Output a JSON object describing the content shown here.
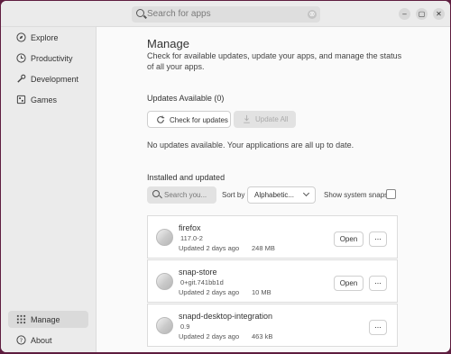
{
  "titlebar": {
    "search_placeholder": "Search for apps",
    "clear_glyph": "⊗",
    "minimize_glyph": "–",
    "maximize_glyph": "▢",
    "close_glyph": "✕"
  },
  "sidebar": {
    "explore": "Explore",
    "productivity": "Productivity",
    "development": "Development",
    "games": "Games",
    "manage": "Manage",
    "about": "About"
  },
  "main": {
    "title": "Manage",
    "description": "Check for available updates, update your apps, and manage the status of all your apps.",
    "updates_heading": "Updates Available (0)",
    "check_updates_label": "Check for updates",
    "update_all_label": "Update All",
    "no_updates_text": "No updates available. Your applications are all up to date.",
    "installed_heading": "Installed and updated",
    "search_placeholder": "Search you...",
    "sort_by_label": "Sort by",
    "sort_value": "Alphabetic...",
    "show_snaps_label": "Show system snaps",
    "show_snaps_checked": false
  },
  "apps": [
    {
      "name": "firefox",
      "version": "117.0-2",
      "updated": "Updated 2 days ago",
      "size": "248 MB",
      "open_label": "Open",
      "more_label": "...",
      "has_open": true
    },
    {
      "name": "snap-store",
      "version": "0+git.741bb1d",
      "updated": "Updated 2 days ago",
      "size": "10 MB",
      "open_label": "Open",
      "more_label": "...",
      "has_open": true
    },
    {
      "name": "snapd-desktop-integration",
      "version": "0.9",
      "updated": "Updated 2 days ago",
      "size": "463 kB",
      "more_label": "...",
      "has_open": false
    }
  ],
  "colors": {
    "desktop_background": "#5e1d3f",
    "window": "#fafafa",
    "sidebar": "#ebebeb",
    "selected_nav": "#dadada"
  }
}
